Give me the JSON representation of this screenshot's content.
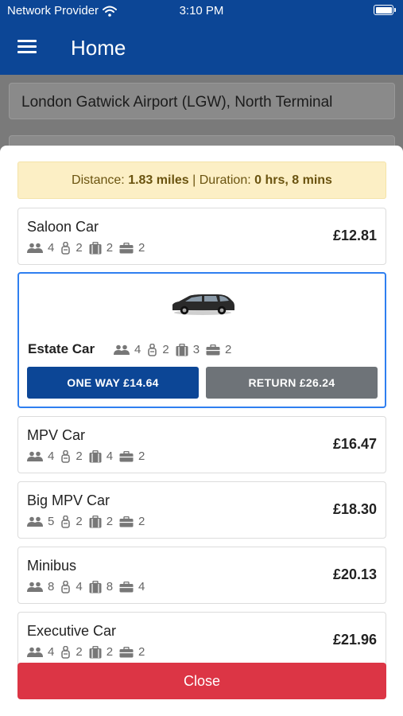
{
  "status_bar": {
    "carrier": "Network Provider",
    "time": "3:10 PM"
  },
  "nav": {
    "title": "Home"
  },
  "booking": {
    "pickup": "London Gatwick Airport (LGW), North Terminal"
  },
  "route_info": {
    "distance_label": "Distance:",
    "distance_value": "1.83 miles",
    "separator": "|",
    "duration_label": "Duration:",
    "duration_value": "0 hrs, 8 mins"
  },
  "vehicles": [
    {
      "name": "Saloon Car",
      "passengers": "4",
      "child_seats": "2",
      "luggage": "2",
      "hand_luggage": "2",
      "price": "£12.81"
    },
    {
      "name": "Estate Car",
      "passengers": "4",
      "child_seats": "2",
      "luggage": "3",
      "hand_luggage": "2",
      "oneway_label": "ONE WAY £14.64",
      "return_label": "RETURN £26.24"
    },
    {
      "name": "MPV Car",
      "passengers": "4",
      "child_seats": "2",
      "luggage": "4",
      "hand_luggage": "2",
      "price": "£16.47"
    },
    {
      "name": "Big MPV Car",
      "passengers": "5",
      "child_seats": "2",
      "luggage": "2",
      "hand_luggage": "2",
      "price": "£18.30"
    },
    {
      "name": "Minibus",
      "passengers": "8",
      "child_seats": "4",
      "luggage": "8",
      "hand_luggage": "4",
      "price": "£20.13"
    },
    {
      "name": "Executive Car",
      "passengers": "4",
      "child_seats": "2",
      "luggage": "2",
      "hand_luggage": "2",
      "price": "£21.96"
    }
  ],
  "close_label": "Close",
  "colors": {
    "primary": "#0c4696",
    "danger": "#dc3545",
    "selected_border": "#2f7ff0",
    "banner_bg": "#fcefc5"
  },
  "icons": [
    "wifi-icon",
    "battery-icon",
    "menu-icon",
    "passengers-icon",
    "child-seat-icon",
    "luggage-icon",
    "hand-luggage-icon",
    "car-image"
  ]
}
